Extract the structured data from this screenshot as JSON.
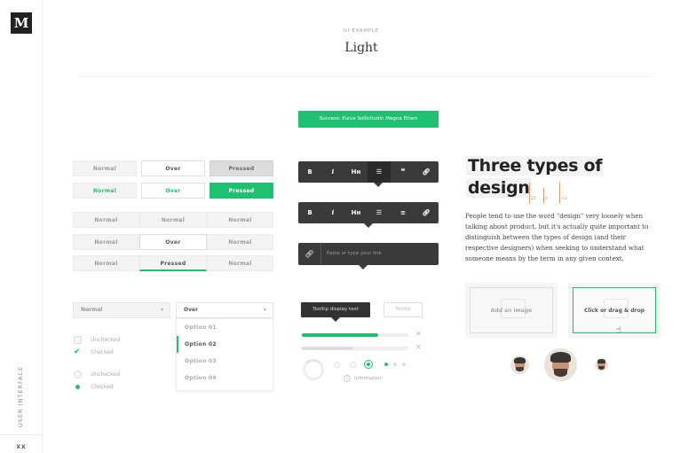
{
  "sidebar": {
    "logo": "M",
    "vertical_label": "USER INTERFACE",
    "footer": "XX"
  },
  "header": {
    "eyebrow": "UI EXAMPLE",
    "title": "Light"
  },
  "alert": {
    "success": "Success: Purus Sollicitudin Magna Etiam"
  },
  "buttons": {
    "row1": [
      "Normal",
      "Over",
      "Pressed"
    ],
    "row2": [
      "Normal",
      "Over",
      "Pressed"
    ],
    "seg1": [
      "Normal",
      "Normal",
      "Normal"
    ],
    "seg2": [
      "Normal",
      "Over",
      "Normal"
    ],
    "seg3": [
      "Normal",
      "Pressed",
      "Normal"
    ]
  },
  "dropdowns": {
    "normal": "Normal",
    "over": "Over",
    "options": [
      "Option 01",
      "Option 02",
      "Option 03",
      "Option 04"
    ],
    "selected": "Option 02"
  },
  "checkboxes": {
    "unchecked": "Unchecked",
    "checked": "Checked"
  },
  "radios": {
    "unchecked": "Unchecked",
    "checked": "Checked"
  },
  "editor": {
    "tools": [
      "B",
      "i",
      "Hн",
      "list-icon",
      "quote-icon",
      "link-icon"
    ],
    "tools2": [
      "B",
      "i",
      "Hн",
      "list-icon",
      "numbered-list-icon",
      "link-icon"
    ],
    "link_placeholder": "Paste or type your link"
  },
  "tooltips": {
    "dark": "Tooltip display text",
    "light": "Tooltip"
  },
  "progress": [
    {
      "value": 0.72,
      "color": "#1fc071"
    },
    {
      "value": 0.48,
      "color": "#dddddd"
    }
  ],
  "loader": {
    "info": "Information"
  },
  "typography": {
    "headline_line1": "Three types of",
    "headline_line2": "design",
    "markers": [
      "25",
      "0",
      "+2"
    ],
    "body": "People tend to use the word \"design\" very loosely when talking about product, but it's actually quite important to distinguish between the types of design (and their respective designers) when seeking to understand what someone means by the term in any given context,"
  },
  "upload": {
    "image": "Add an image",
    "drag": "Click or drag & drop"
  },
  "colors": {
    "accent": "#1fc071",
    "dark": "#3a3a3a"
  }
}
